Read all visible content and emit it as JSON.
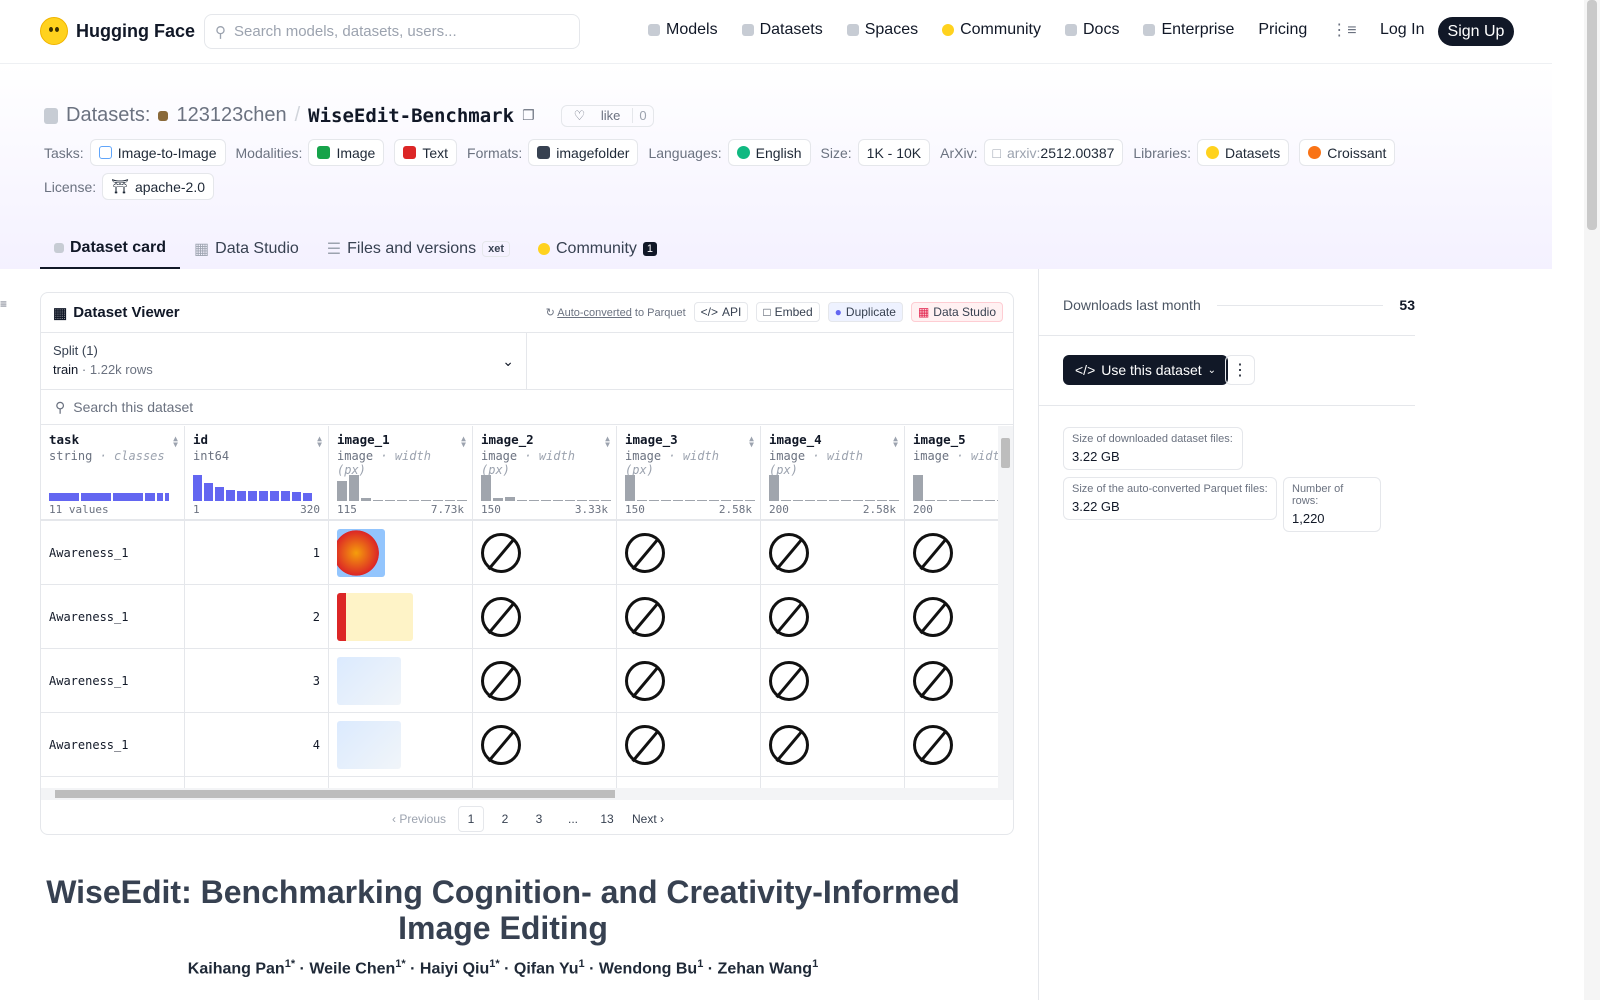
{
  "nav": {
    "brand": "Hugging Face",
    "search_placeholder": "Search models, datasets, users...",
    "links": [
      "Models",
      "Datasets",
      "Spaces",
      "Community",
      "Docs",
      "Enterprise",
      "Pricing"
    ],
    "login": "Log In",
    "signup": "Sign Up"
  },
  "repo": {
    "section": "Datasets:",
    "owner": "123123chen",
    "name": "WiseEdit-Benchmark",
    "like": "like",
    "likes": "0"
  },
  "meta": {
    "tasks_label": "Tasks:",
    "task": "Image-to-Image",
    "modalities_label": "Modalities:",
    "modalities": [
      "Image",
      "Text"
    ],
    "formats_label": "Formats:",
    "format": "imagefolder",
    "languages_label": "Languages:",
    "language": "English",
    "size_label": "Size:",
    "size": "1K - 10K",
    "arxiv_label": "ArXiv:",
    "arxiv_prefix": "arxiv:",
    "arxiv_id": "2512.00387",
    "libraries_label": "Libraries:",
    "libraries": [
      "Datasets",
      "Croissant"
    ],
    "license_label": "License:",
    "license": "apache-2.0"
  },
  "tabs": {
    "card": "Dataset card",
    "studio": "Data Studio",
    "files": "Files and versions",
    "xet": "xet",
    "community": "Community",
    "community_count": "1"
  },
  "viewer": {
    "title": "Dataset Viewer",
    "auto": "Auto-converted",
    "auto_suffix": "to Parquet",
    "api": "API",
    "embed": "Embed",
    "duplicate": "Duplicate",
    "data_studio": "Data Studio",
    "split_label": "Split (1)",
    "split_name": "train",
    "split_rows": "1.22k rows",
    "search_placeholder": "Search this dataset",
    "columns": [
      {
        "name": "task",
        "type": "string",
        "sub": "classes",
        "min": "11 values",
        "max": ""
      },
      {
        "name": "id",
        "type": "int64",
        "sub": "",
        "min": "1",
        "max": "320"
      },
      {
        "name": "image_1",
        "type": "image",
        "sub": "width (px)",
        "min": "115",
        "max": "7.73k"
      },
      {
        "name": "image_2",
        "type": "image",
        "sub": "width (px)",
        "min": "150",
        "max": "3.33k"
      },
      {
        "name": "image_3",
        "type": "image",
        "sub": "width (px)",
        "min": "150",
        "max": "2.58k"
      },
      {
        "name": "image_4",
        "type": "image",
        "sub": "width (px)",
        "min": "200",
        "max": "2.58k"
      },
      {
        "name": "image_5",
        "type": "image",
        "sub": "width",
        "min": "200",
        "max": ""
      }
    ],
    "rows": [
      {
        "task": "Awareness_1",
        "id": "1"
      },
      {
        "task": "Awareness_1",
        "id": "2"
      },
      {
        "task": "Awareness_1",
        "id": "3"
      },
      {
        "task": "Awareness_1",
        "id": "4"
      }
    ],
    "pager": {
      "prev": "Previous",
      "pages": [
        "1",
        "2",
        "3",
        "...",
        "13"
      ],
      "next": "Next"
    }
  },
  "sidebar": {
    "downloads_label": "Downloads last month",
    "downloads": "53",
    "use": "Use this dataset",
    "dl_size_label": "Size of downloaded dataset files:",
    "dl_size": "3.22 GB",
    "pq_size_label": "Size of the auto-converted Parquet files:",
    "pq_size": "3.22 GB",
    "rows_label": "Number of rows:",
    "rows": "1,220"
  },
  "readme": {
    "title": "WiseEdit: Benchmarking Cognition- and Creativity-Informed Image Editing",
    "authors": [
      "Kaihang Pan",
      "Weile Chen",
      "Haiyi Qiu",
      "Qifan Yu",
      "Wendong Bu",
      "Zehan Wang"
    ],
    "marks": [
      "1*",
      "1*",
      "1*",
      "1",
      "1",
      "1"
    ]
  },
  "colors": {
    "accent": "#111827",
    "hist_task": "#6366f1",
    "hist": "#a0a5ad"
  }
}
